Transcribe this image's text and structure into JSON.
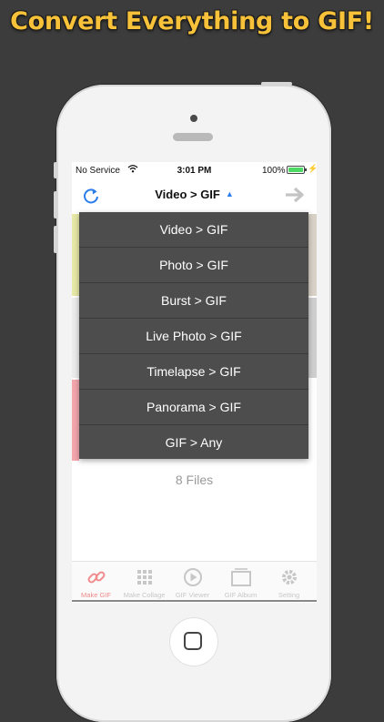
{
  "headline": "Convert Everything to GIF!",
  "status": {
    "carrier": "No Service",
    "time": "3:01 PM",
    "battery": "100%"
  },
  "navbar": {
    "title": "Video > GIF",
    "dropdown_arrow": "▲"
  },
  "dropdown": {
    "items": [
      {
        "label": "Video > GIF"
      },
      {
        "label": "Photo > GIF"
      },
      {
        "label": "Burst > GIF"
      },
      {
        "label": "Live Photo > GIF"
      },
      {
        "label": "Timelapse > GIF"
      },
      {
        "label": "Panorama > GIF"
      },
      {
        "label": "GIF > Any"
      }
    ]
  },
  "files_count": "8 Files",
  "tabs": [
    {
      "label": "Make GIF",
      "icon": "link-icon"
    },
    {
      "label": "Make Collage",
      "icon": "grid-icon"
    },
    {
      "label": "GIF Viewer",
      "icon": "play-icon"
    },
    {
      "label": "GIF Album",
      "icon": "album-icon"
    },
    {
      "label": "Setting",
      "icon": "gear-icon"
    }
  ],
  "colors": {
    "accent": "#2b7de9",
    "headline": "#f7c23a",
    "active_tab": "#f08a8a",
    "menu_bg": "#4d4d4d"
  }
}
